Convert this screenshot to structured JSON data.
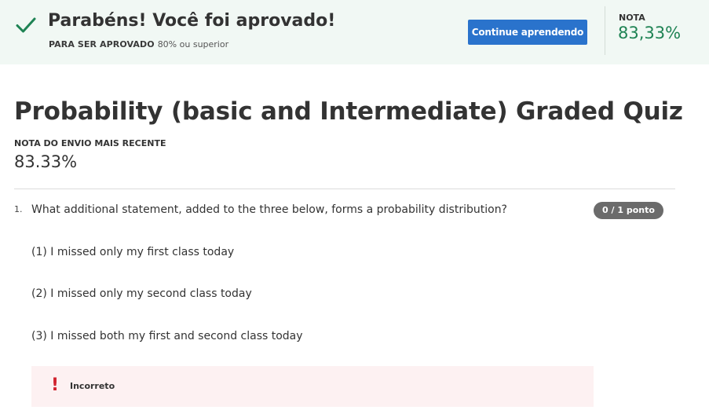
{
  "banner": {
    "title": "Parabéns! Você foi aprovado!",
    "requirement_label": "PARA SER APROVADO",
    "requirement_value": "80% ou superior",
    "continue_label": "Continue aprendendo",
    "grade_label": "NOTA",
    "grade_value": "83,33%"
  },
  "quiz": {
    "title": "Probability (basic and Intermediate) Graded Quiz",
    "recent_label": "NOTA DO ENVIO MAIS RECENTE",
    "recent_value": "83.33%"
  },
  "question": {
    "number": "1.",
    "text": "What additional statement, added to the three below, forms a probability distribution?",
    "points": "0 / 1 ponto",
    "statements": [
      "(1) I missed only my first class today",
      "(2) I missed only my second class today",
      "(3) I missed both my first and second class today"
    ],
    "feedback": "Incorreto"
  },
  "colors": {
    "banner_bg": "#f1f8f4",
    "success_green": "#1f8354",
    "button_blue": "#2a73cc",
    "error_red": "#d1222e",
    "feedback_bg": "#fdf1f2"
  },
  "icons": {
    "banner": "check-icon",
    "feedback": "exclamation-icon"
  }
}
